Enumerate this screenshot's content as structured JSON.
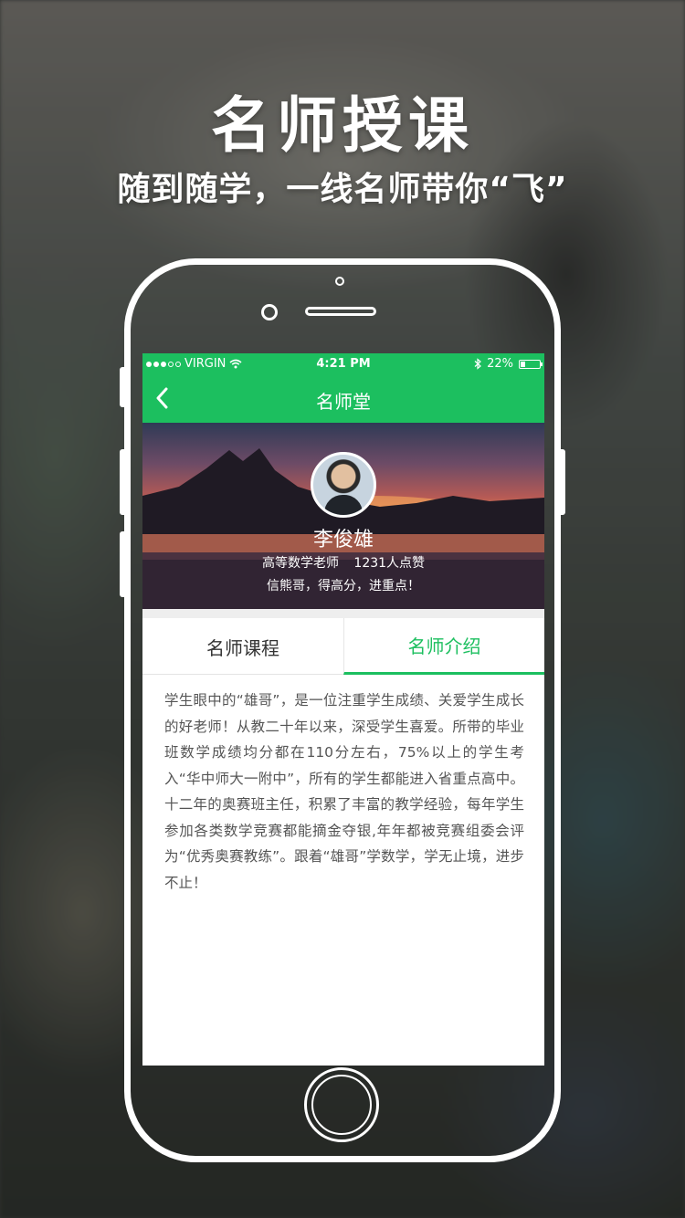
{
  "promo": {
    "headline": "名师授课",
    "subline": "随到随学，一线名师带你“飞”"
  },
  "status_bar": {
    "carrier": "VIRGIN",
    "time": "4:21 PM",
    "battery": "22%"
  },
  "nav": {
    "title": "名师堂"
  },
  "teacher": {
    "name": "李俊雄",
    "title": "高等数学老师",
    "likes": "1231人点赞",
    "motto": "信熊哥，得高分，进重点！"
  },
  "tabs": [
    {
      "label": "名师课程",
      "active": false
    },
    {
      "label": "名师介绍",
      "active": true
    }
  ],
  "intro": {
    "text": "学生眼中的“雄哥”，是一位注重学生成绩、关爱学生成长的好老师！从教二十年以来，深受学生喜爱。所带的毕业班数学成绩均分都在110分左右，75%以上的学生考入“华中师大一附中”，所有的学生都能进入省重点高中。十二年的奥赛班主任，积累了丰富的教学经验，每年学生参加各类数学竞赛都能摘金夺银,年年都被竞赛组委会评为“优秀奥赛教练”。跟着“雄哥”学数学，学无止境，进步不止！"
  },
  "colors": {
    "accent": "#1cbf5f"
  }
}
